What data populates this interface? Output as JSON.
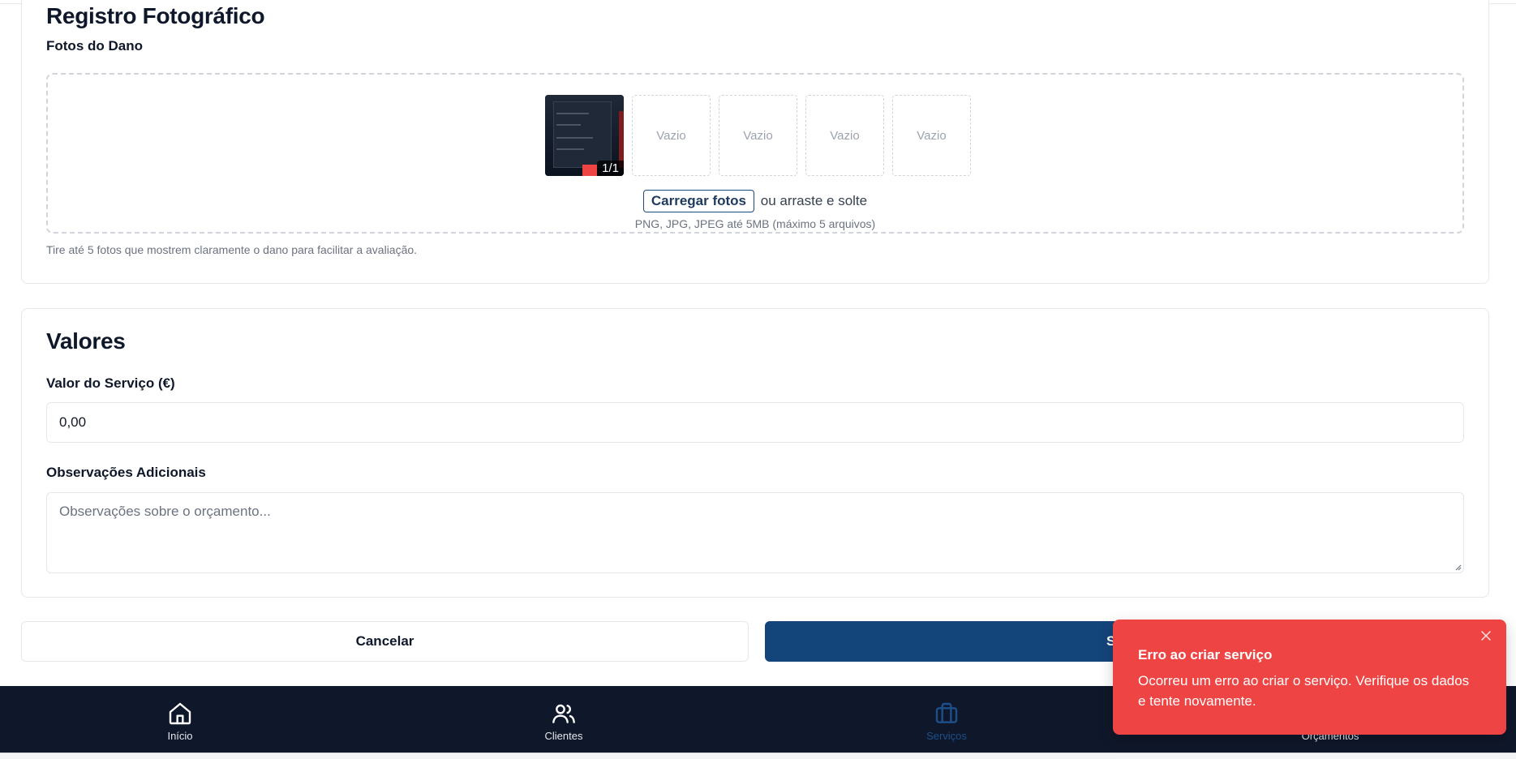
{
  "photos_section": {
    "title": "Registro Fotográfico",
    "label": "Fotos do Dano",
    "thumbnail_counter": "1/1",
    "empty_slot_label": "Vazio",
    "upload_button": "Carregar fotos",
    "upload_or": "ou arraste e solte",
    "file_hint": "PNG, JPG, JPEG até 5MB (máximo 5 arquivos)",
    "help_text": "Tire até 5 fotos que mostrem claramente o dano para facilitar a avaliação."
  },
  "values_section": {
    "title": "Valores",
    "service_value_label": "Valor do Serviço (€)",
    "service_value": "0,00",
    "notes_label": "Observações Adicionais",
    "notes_placeholder": "Observações sobre o orçamento..."
  },
  "actions": {
    "cancel": "Cancelar",
    "save": "Salvar"
  },
  "bottom_nav": {
    "items": [
      {
        "label": "Início",
        "icon": "home-icon"
      },
      {
        "label": "Clientes",
        "icon": "users-icon"
      },
      {
        "label": "Serviços",
        "icon": "briefcase-icon",
        "active": true
      },
      {
        "label": "Orçamentos",
        "icon": "document-icon"
      }
    ]
  },
  "toast": {
    "title": "Erro ao criar serviço",
    "message": "Ocorreu um erro ao criar o serviço. Verifique os dados e tente novamente.",
    "color": "#ef4444"
  },
  "colors": {
    "primary": "#14457a",
    "nav_background": "#0f172a",
    "error": "#ef4444"
  }
}
